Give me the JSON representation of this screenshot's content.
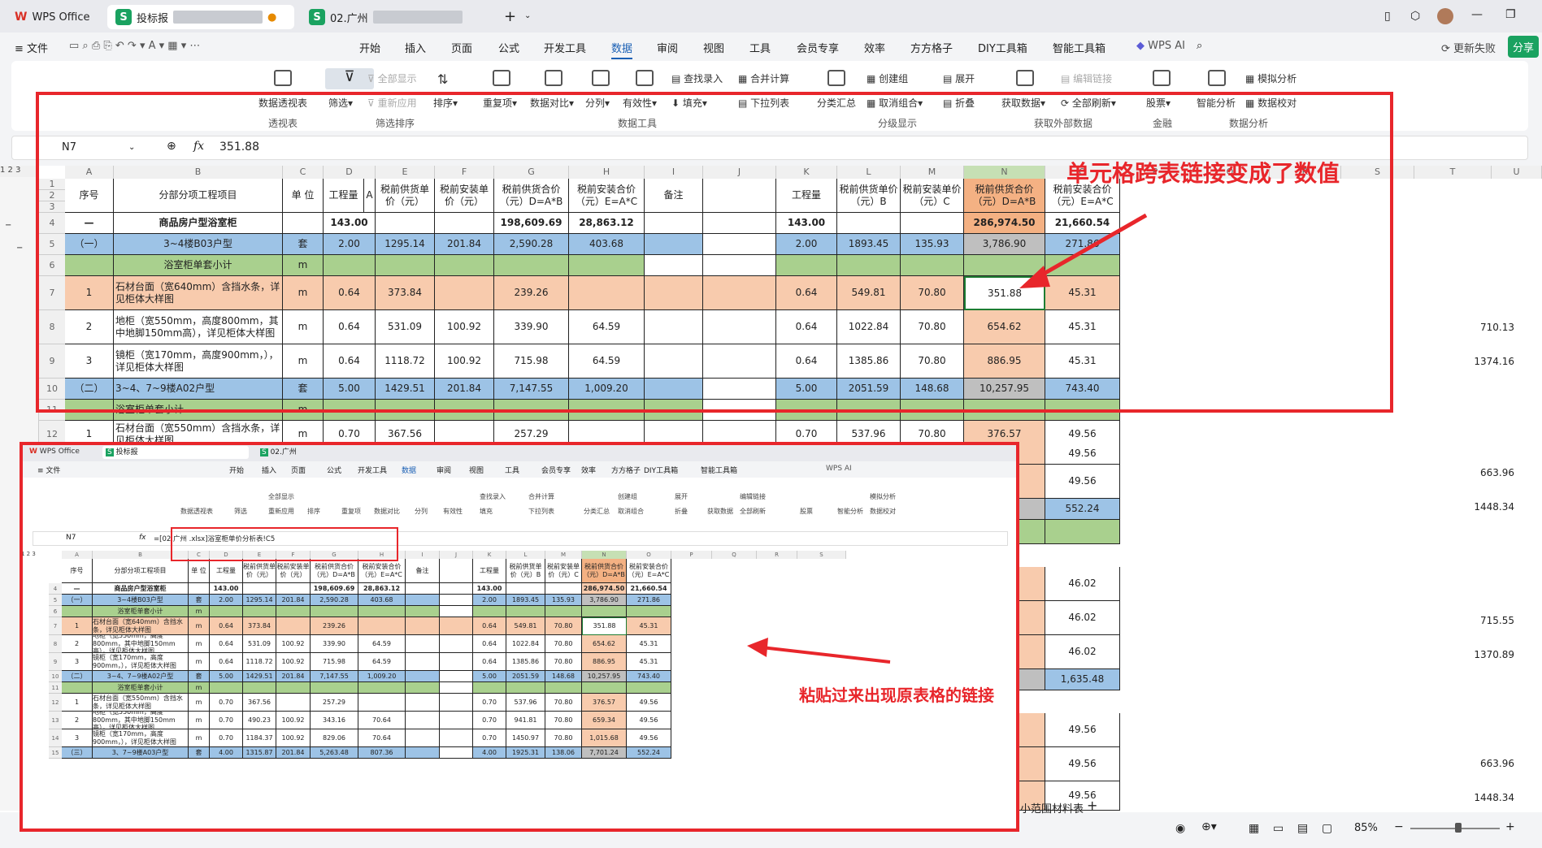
{
  "app": {
    "name": "WPS Office",
    "tab1": "投标报",
    "tab2": "02.广州"
  },
  "menu": {
    "file": "文件",
    "items": [
      "开始",
      "插入",
      "页面",
      "公式",
      "开发工具",
      "数据",
      "审阅",
      "视图",
      "工具",
      "会员专享",
      "效率",
      "方方格子",
      "DIY工具箱",
      "智能工具箱"
    ],
    "wps_ai": "WPS AI",
    "update": "更新失败",
    "share": "分享"
  },
  "ribbon": {
    "pivot": "数据透视表",
    "pivot_group": "透视表",
    "filter": "筛选",
    "show_all": "全部显示",
    "reapply": "重新应用",
    "sort": "排序",
    "filter_group": "筛选排序",
    "dup": "重复项",
    "compare": "数据对比",
    "split": "分列",
    "valid": "有效性",
    "fill": "填充",
    "lookup": "查找录入",
    "merge_calc": "合并计算",
    "dropdown": "下拉列表",
    "tools_group": "数据工具",
    "subtotal": "分类汇总",
    "create_group": "创建组",
    "ungroup": "取消组合",
    "expand": "展开",
    "collapse": "折叠",
    "outline_group": "分级显示",
    "get_data": "获取数据",
    "edit_links": "编辑链接",
    "refresh_all": "全部刷新",
    "ext_group": "获取外部数据",
    "stock": "股票",
    "finance_group": "金融",
    "smart": "智能分析",
    "simulate": "模拟分析",
    "validate": "数据校对",
    "analysis_group": "数据分析"
  },
  "formula": {
    "namebox": "N7",
    "fx": "fx",
    "value": "351.88",
    "inset_value": "=[02.广州                                                                .xlsx]浴室柜单价分析表!C5"
  },
  "columns": [
    "A",
    "B",
    "C",
    "D",
    "E",
    "F",
    "G",
    "H",
    "I",
    "J",
    "K",
    "L",
    "M",
    "N",
    "O",
    "P",
    "Q",
    "R",
    "S",
    "T",
    "U"
  ],
  "headers": {
    "seq": "序号",
    "item": "分部分项工程项目",
    "unit": "单 位",
    "qty": "工程量",
    "qty_a": "A",
    "supply_price": "税前供货单价（元）",
    "install_price": "税前安装单价（元）",
    "supply_total": "税前供货合价（元）D=A*B",
    "install_total": "税前安装合价（元）E=A*C",
    "remark": "备注",
    "k_qty": "工程量",
    "k_qty_a": "A",
    "l_price": "税前供货单价（元）B",
    "m_price": "税前安装单价（元）C",
    "n_total": "税前供货合价（元）D=A*B",
    "o_total": "税前安装合价（元）E=A*C"
  },
  "rows": [
    {
      "n": "4",
      "seq": "—",
      "item": "商品房户型浴室柜",
      "unit": "",
      "d": "143.00",
      "e": "",
      "f": "",
      "g": "198,609.69",
      "h": "28,863.12",
      "k": "143.00",
      "l": "",
      "m": "",
      "nn": "286,974.50",
      "o": "21,660.54"
    },
    {
      "n": "5",
      "seq": "（一）",
      "item": "3~4楼B03户型",
      "unit": "套",
      "d": "2.00",
      "e": "1295.14",
      "f": "201.84",
      "g": "2,590.28",
      "h": "403.68",
      "k": "2.00",
      "l": "1893.45",
      "m": "135.93",
      "nn": "3,786.90",
      "o": "271.86"
    },
    {
      "n": "6",
      "seq": "",
      "item": "浴室柜单套小计",
      "unit": "m",
      "d": "",
      "e": "",
      "f": "",
      "g": "",
      "h": "",
      "k": "",
      "l": "",
      "m": "",
      "nn": "",
      "o": ""
    },
    {
      "n": "7",
      "seq": "1",
      "item": "石材台面（宽640mm）含挡水条，详见柜体大样图",
      "unit": "m",
      "d": "0.64",
      "e": "373.84",
      "f": "",
      "g": "239.26",
      "h": "",
      "k": "0.64",
      "l": "549.81",
      "m": "70.80",
      "nn": "351.88",
      "o": "45.31"
    },
    {
      "n": "8",
      "seq": "2",
      "item": "地柜（宽550mm，高度800mm，其中地脚150mm高），详见柜体大样图",
      "unit": "m",
      "d": "0.64",
      "e": "531.09",
      "f": "100.92",
      "g": "339.90",
      "h": "64.59",
      "k": "0.64",
      "l": "1022.84",
      "m": "70.80",
      "nn": "654.62",
      "o": "45.31",
      "t": "710.13"
    },
    {
      "n": "9",
      "seq": "3",
      "item": "镜柜（宽170mm，高度900mm，），详见柜体大样图",
      "unit": "m",
      "d": "0.64",
      "e": "1118.72",
      "f": "100.92",
      "g": "715.98",
      "h": "64.59",
      "k": "0.64",
      "l": "1385.86",
      "m": "70.80",
      "nn": "886.95",
      "o": "45.31",
      "t": "1374.16"
    },
    {
      "n": "10",
      "seq": "（二）",
      "item": "3~4、7~9楼A02户型",
      "unit": "套",
      "d": "5.00",
      "e": "1429.51",
      "f": "201.84",
      "g": "7,147.55",
      "h": "1,009.20",
      "k": "5.00",
      "l": "2051.59",
      "m": "148.68",
      "nn": "10,257.95",
      "o": "743.40"
    },
    {
      "n": "11",
      "seq": "",
      "item": "浴室柜单套小计",
      "unit": "m"
    },
    {
      "n": "12",
      "seq": "1",
      "item": "石材台面（宽550mm）含挡水条，详见柜体大样图",
      "unit": "m",
      "d": "0.70",
      "e": "367.56",
      "g": "257.29",
      "k": "0.70",
      "l": "537.96",
      "m": "70.80",
      "nn": "376.57",
      "o": "49.56"
    }
  ],
  "right_col": {
    "o13": "49.56",
    "o14": "49.56",
    "o15": "552.24",
    "o16": "",
    "o17": "46.02",
    "o18": "46.02",
    "o19": "46.02",
    "o20": "1,635.48",
    "o22": "49.56",
    "o23": "49.56",
    "o24": "49.56",
    "t13": "663.96",
    "t14": "1448.34",
    "t17": "715.55",
    "t18": "1370.89",
    "t23": "663.96",
    "t24": "1448.34"
  },
  "inset_rows": [
    {
      "n": "4",
      "seq": "—",
      "item": "商品房户型浴室柜",
      "unit": "",
      "d": "143.00",
      "e": "",
      "f": "",
      "g": "198,609.69",
      "h": "28,863.12",
      "k": "143.00",
      "l": "",
      "m": "",
      "nn": "286,974.50",
      "o": "21,660.54"
    },
    {
      "n": "5",
      "seq": "（一）",
      "item": "3~4楼B03户型",
      "unit": "套",
      "d": "2.00",
      "e": "1295.14",
      "f": "201.84",
      "g": "2,590.28",
      "h": "403.68",
      "k": "2.00",
      "l": "1893.45",
      "m": "135.93",
      "nn": "3,786.90",
      "o": "271.86"
    },
    {
      "n": "6",
      "seq": "",
      "item": "浴室柜单套小计",
      "unit": "m"
    },
    {
      "n": "7",
      "seq": "1",
      "item": "石材台面（宽640mm）含挡水条，详见柜体大样图",
      "unit": "m",
      "d": "0.64",
      "e": "373.84",
      "f": "",
      "g": "239.26",
      "h": "",
      "k": "0.64",
      "l": "549.81",
      "m": "70.80",
      "nn": "351.88",
      "o": "45.31"
    },
    {
      "n": "8",
      "seq": "2",
      "item": "地柜（宽550mm，高度800mm，其中地脚150mm高），详见柜体大样图",
      "unit": "m",
      "d": "0.64",
      "e": "531.09",
      "f": "100.92",
      "g": "339.90",
      "h": "64.59",
      "k": "0.64",
      "l": "1022.84",
      "m": "70.80",
      "nn": "654.62",
      "o": "45.31"
    },
    {
      "n": "9",
      "seq": "3",
      "item": "镜柜（宽170mm，高度900mm，），详见柜体大样图",
      "unit": "m",
      "d": "0.64",
      "e": "1118.72",
      "f": "100.92",
      "g": "715.98",
      "h": "64.59",
      "k": "0.64",
      "l": "1385.86",
      "m": "70.80",
      "nn": "886.95",
      "o": "45.31"
    },
    {
      "n": "10",
      "seq": "（二）",
      "item": "3~4、7~9楼A02户型",
      "unit": "套",
      "d": "5.00",
      "e": "1429.51",
      "f": "201.84",
      "g": "7,147.55",
      "h": "1,009.20",
      "k": "5.00",
      "l": "2051.59",
      "m": "148.68",
      "nn": "10,257.95",
      "o": "743.40"
    },
    {
      "n": "11",
      "seq": "",
      "item": "浴室柜单套小计",
      "unit": "m"
    },
    {
      "n": "12",
      "seq": "1",
      "item": "石材台面（宽550mm）含挡水条，详见柜体大样图",
      "unit": "m",
      "d": "0.70",
      "e": "367.56",
      "f": "",
      "g": "257.29",
      "h": "",
      "k": "0.70",
      "l": "537.96",
      "m": "70.80",
      "nn": "376.57",
      "o": "49.56"
    },
    {
      "n": "13",
      "seq": "2",
      "item": "地柜（宽550mm，高度800mm，其中地脚150mm高），详见柜体大样图",
      "unit": "m",
      "d": "0.70",
      "e": "490.23",
      "f": "100.92",
      "g": "343.16",
      "h": "70.64",
      "k": "0.70",
      "l": "941.81",
      "m": "70.80",
      "nn": "659.34",
      "o": "49.56"
    },
    {
      "n": "14",
      "seq": "3",
      "item": "镜柜（宽170mm，高度900mm，），详见柜体大样图",
      "unit": "m",
      "d": "0.70",
      "e": "1184.37",
      "f": "100.92",
      "g": "829.06",
      "h": "70.64",
      "k": "0.70",
      "l": "1450.97",
      "m": "70.80",
      "nn": "1,015.68",
      "o": "49.56"
    },
    {
      "n": "15",
      "seq": "（三）",
      "item": "3、7~9楼A03户型",
      "unit": "套",
      "d": "4.00",
      "e": "1315.87",
      "f": "201.84",
      "g": "5,263.48",
      "h": "807.36",
      "k": "4.00",
      "l": "1925.31",
      "m": "138.06",
      "nn": "7,701.24",
      "o": "552.24"
    }
  ],
  "annotations": {
    "top": "单元格跨表链接变成了数值",
    "bottom": "粘贴过来出现原表格的链接"
  },
  "status": {
    "sheet_tab": "小范围材料表",
    "zoom": "85%"
  },
  "colors": {
    "accent": "#e8262b",
    "blue": "#9dc3e6",
    "green": "#a9d08e",
    "orange": "#f8cbad"
  }
}
